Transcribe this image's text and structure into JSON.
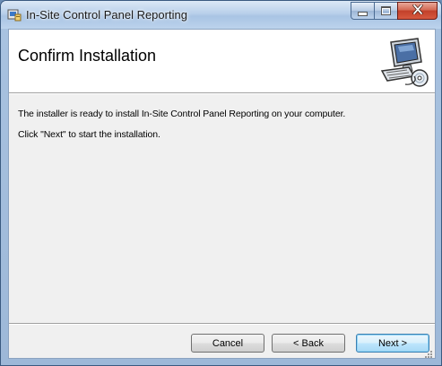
{
  "window": {
    "title": "In-Site Control Panel Reporting",
    "icon": "installer-icon",
    "controls": {
      "minimize": "minimize-icon",
      "maximize": "maximize-icon",
      "close": "close-icon"
    }
  },
  "header": {
    "title": "Confirm Installation",
    "graphic": "computer-setup-icon"
  },
  "body": {
    "line1": "The installer is ready to install In-Site Control Panel Reporting on your computer.",
    "line2": "Click \"Next\" to start the installation."
  },
  "buttons": {
    "cancel": "Cancel",
    "back": "< Back",
    "next": "Next >"
  },
  "colors": {
    "accent_close": "#c2402a",
    "default_button_border": "#3c7fb1"
  }
}
